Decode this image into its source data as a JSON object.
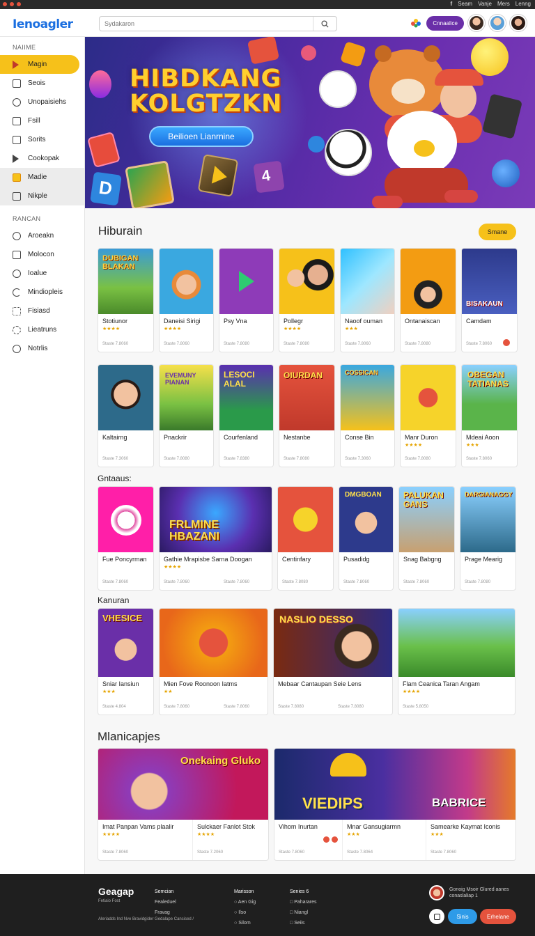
{
  "topbar": {
    "links": [
      "Seam",
      "Vanje",
      "Mers",
      "Lenng"
    ]
  },
  "header": {
    "logo": "Ienoagler",
    "search_placeholder": "Sydakaron",
    "cta_label": "Cnnaalice"
  },
  "sidebar": {
    "section1": "NAIIME",
    "items": [
      {
        "label": "Magin",
        "icon": "play-icon"
      },
      {
        "label": "Seois",
        "icon": "calendar-icon"
      },
      {
        "label": "Unopaisiehs",
        "icon": "clock-icon"
      },
      {
        "label": "Fsill",
        "icon": "square-icon"
      },
      {
        "label": "Sorits",
        "icon": "document-icon"
      },
      {
        "label": "Cookopak",
        "icon": "play-icon"
      },
      {
        "label": "Madie",
        "icon": "bolt-icon"
      },
      {
        "label": "Nikple",
        "icon": "image-icon"
      }
    ],
    "section2": "RANCAN",
    "items2": [
      {
        "label": "Aroeakn",
        "icon": "circle-icon"
      },
      {
        "label": "Molocon",
        "icon": "document-icon"
      },
      {
        "label": "Ioalue",
        "icon": "circle-icon"
      },
      {
        "label": "Mindiopleis",
        "icon": "refresh-icon"
      },
      {
        "label": "Fisiasd",
        "icon": "grid-icon"
      },
      {
        "label": "Lieatruns",
        "icon": "gear-icon"
      },
      {
        "label": "Notrlis",
        "icon": "circle-icon"
      }
    ]
  },
  "hero": {
    "title_line1": "HIBDKANG",
    "title_line2": "KOLGTZKN",
    "button": "Beilioen Lianrnine"
  },
  "sections": {
    "s1": "Hiburain",
    "s1_button": "Smane",
    "s2": "Gntaaus:",
    "s3": "Kanuran",
    "s4": "Mlanicapjes"
  },
  "row1": [
    {
      "title": "Stotiunor",
      "meta": "Staste 7.8060"
    },
    {
      "title": "Daneisi Sirigi",
      "meta": "Staste 7.8060"
    },
    {
      "title": "Psy Vna",
      "meta": "Staste 7.8080"
    },
    {
      "title": "Pollegr",
      "meta": "Staste 7.8080"
    },
    {
      "title": "Naoof ouman",
      "meta": "Staste 7.8060"
    },
    {
      "title": "Ontanaiscan",
      "meta": "Staste 7.8080"
    },
    {
      "title": "Camdam",
      "meta": "Staste 7.8060"
    }
  ],
  "row2": [
    {
      "title": "Kaltairng",
      "meta": "Staste 7.3060"
    },
    {
      "title": "Pnackrir",
      "meta": "Staste 7.8080"
    },
    {
      "title": "Courfenland",
      "meta": "Staste 7.8380"
    },
    {
      "title": "Nestanbe",
      "meta": "Staste 7.8080"
    },
    {
      "title": "Conse Bin",
      "meta": "Staste 7.3060"
    },
    {
      "title": "Manr Duron",
      "meta": "Staste 7.8080"
    },
    {
      "title": "Mdeai Aoon",
      "meta": "Staste 7.8060"
    }
  ],
  "row3": [
    {
      "title": "Fue Poncyrman",
      "meta": "Staste 7.8060"
    },
    {
      "title": "Gathie Mrapisbe Sarna Doogan",
      "meta": "Staste 7.8060"
    },
    {
      "title": "Centinfary",
      "meta": "Staste 7.8080"
    },
    {
      "title": "Pusadidg",
      "meta": "Staste 7.8060"
    },
    {
      "title": "Snag Babgng",
      "meta": "Staste 7.8060"
    },
    {
      "title": "Prage Mearig",
      "meta": "Staste 7.8080"
    }
  ],
  "row4": [
    {
      "title": "Sniar Iansiun",
      "meta": "Staste 4.804"
    },
    {
      "title": "Mien Fove Roonoon Iatms",
      "meta": "Staste 7.8060"
    },
    {
      "title": "Mebaar Cantaupan Seie Lens",
      "meta": "Staste 7.8080"
    },
    {
      "title": "Flam Ceanica Taran Angam",
      "meta": "Staste 5.8050"
    }
  ],
  "row5": [
    {
      "title": "Imat Panpan Vams plaalir",
      "meta": "Staste 7.8060"
    },
    {
      "title": "Sulckaer Fanlot Stok",
      "meta": "Staste 7.2060"
    },
    {
      "title": "Vihom Inurtan",
      "meta": "Staste 7.8060"
    },
    {
      "title": "Mnar Gansugiarmn",
      "meta": "Staste 7.8064"
    },
    {
      "title": "Samearke Kaymat Iconis",
      "meta": "Staste 7.8060"
    }
  ],
  "banners": {
    "b1": "Onekaing Gluko",
    "b2": "VIEDIPS",
    "b3": "BABRICE",
    "thumbs": {
      "r1c1": "DUBIGAN BLAKAN",
      "r1c7": "BISAKAUN",
      "r2c2": "EVEMUNY PIANAN",
      "r2c3": "LESOCI ALAL",
      "r2c4": "OIURDAN",
      "r2c5": "COSSICAN",
      "r2c7": "OBEGAN TATIANAS",
      "r3c2": "FRLMINE HBAZANI",
      "r3c4": "DMGBOAN",
      "r3c5": "PALUKAN GANS",
      "r3c6": "DARGIANAGGY",
      "r4c1": "VHESICE",
      "r4c3": "NASLIO DESSO"
    }
  },
  "footer": {
    "logo": "Geagap",
    "tagline": "Fetiaio Fost",
    "legal": "Aleriadds Ind Nve Bravidgider Gedalape Cancised /",
    "col1": {
      "head": "Semcian",
      "items": [
        "Fealeduel",
        "Fravag"
      ]
    },
    "col2": {
      "head": "Marisson",
      "items": [
        "Aen Gig",
        "Ilso",
        "Silom"
      ]
    },
    "col3": {
      "head": "Senies 6",
      "items": [
        "Paharares",
        "Niangl",
        "Seiis"
      ]
    },
    "user_text": "Gonoig Msoir Glured aanes conaslaliap 1",
    "btn1": "Sinis",
    "btn2": "Erhelane"
  },
  "colors": {
    "accent": "#f6c11a",
    "brand": "#6a2fa8",
    "cta": "#1b6fe0",
    "danger": "#e5533d"
  }
}
